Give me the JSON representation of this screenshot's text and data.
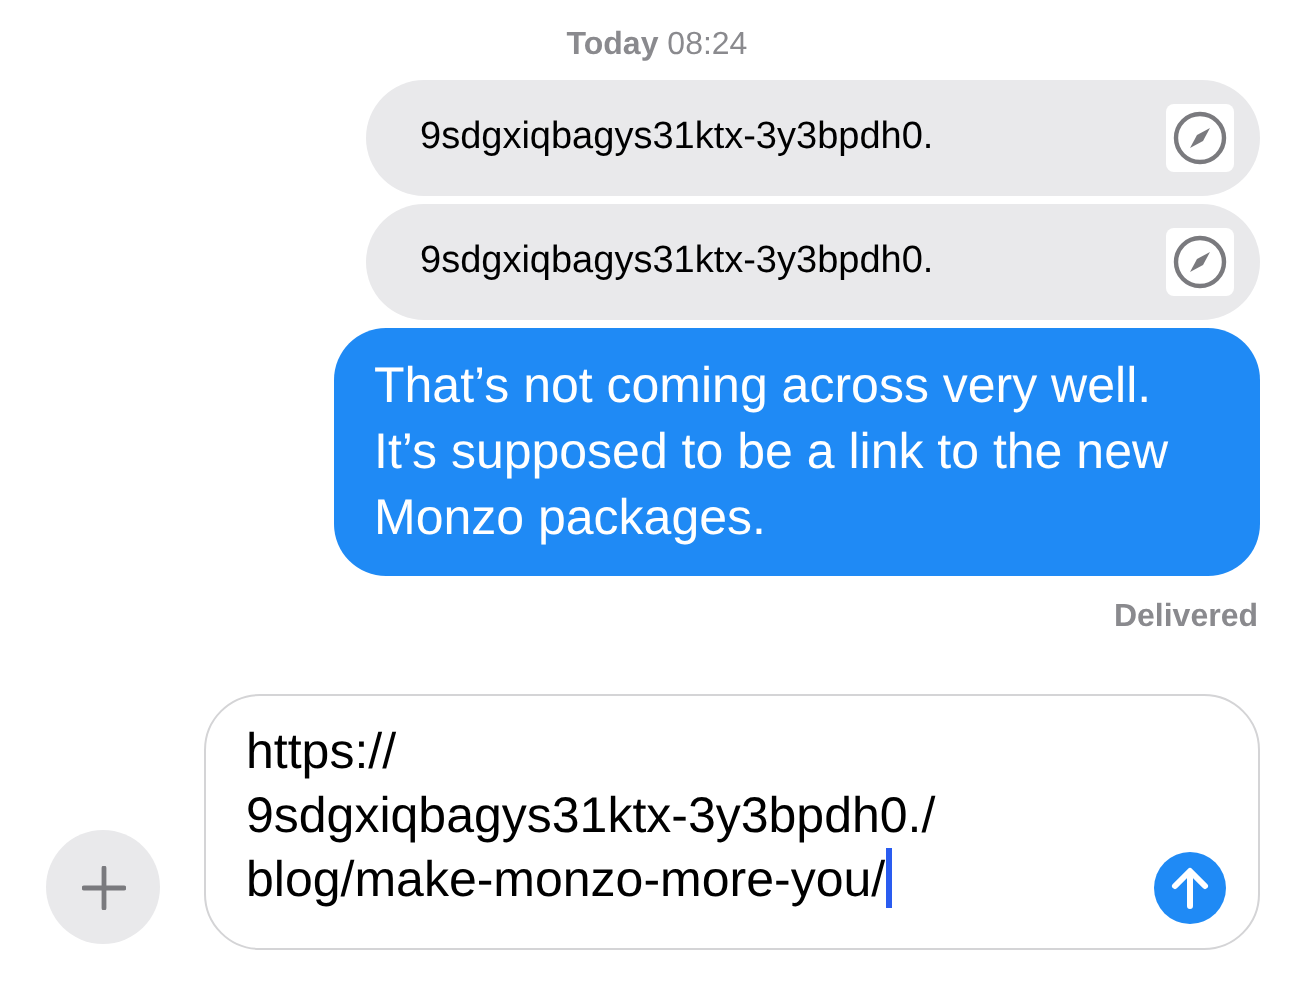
{
  "timestamp": "**Today** 08:24",
  "messages": [
    {
      "kind": "link",
      "text": "9sdgxiqbagys31ktx-3y3bpdh0."
    },
    {
      "kind": "link",
      "text": "9sdgxiqbagys31ktx-3y3bpdh0."
    },
    {
      "kind": "text",
      "text": "That’s not coming across very well. It’s supposed to be a link to the new Monzo packages."
    }
  ],
  "status": "Delivered",
  "compose": {
    "value": "https://\n9sdgxiqbagys31ktx-3y3bpdh0./\nblog/make-monzo-more-you/",
    "caret": true
  }
}
